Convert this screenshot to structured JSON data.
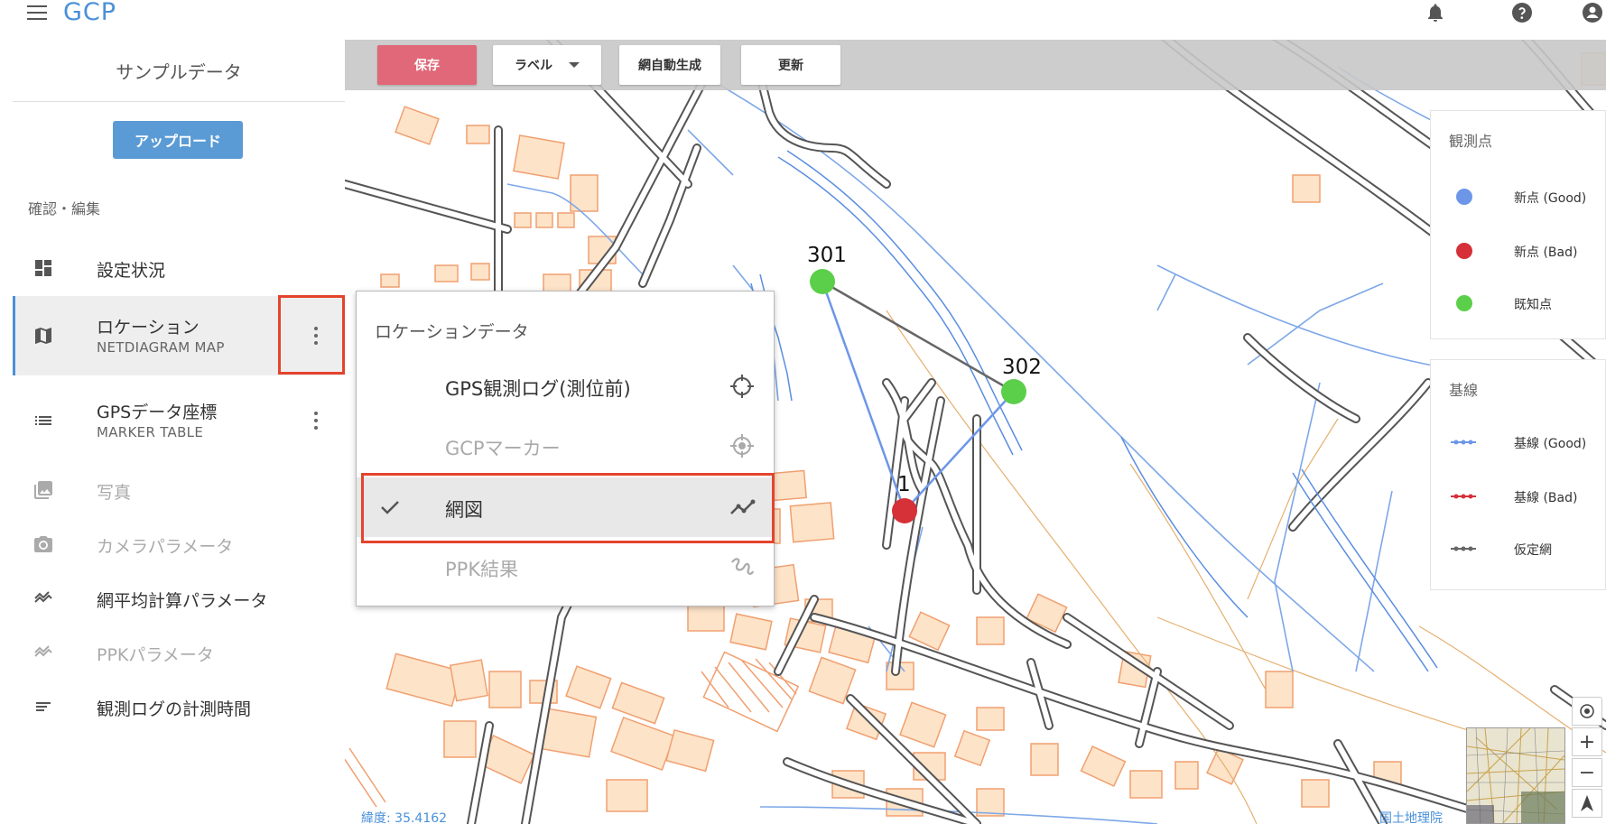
{
  "app": {
    "title": "GCP"
  },
  "sidebar": {
    "project_name": "サンプルデータ",
    "upload_label": "アップロード",
    "section_label": "確認・編集",
    "items": [
      {
        "label": "設定状況",
        "sub": "",
        "icon": "dashboard-icon",
        "state": "normal"
      },
      {
        "label": "ロケーション",
        "sub": "NETDIAGRAM MAP",
        "icon": "map-icon",
        "state": "active"
      },
      {
        "label": "GPSデータ座標",
        "sub": "MARKER TABLE",
        "icon": "list-icon",
        "state": "normal"
      },
      {
        "label": "写真",
        "sub": "",
        "icon": "photo-icon",
        "state": "disabled"
      },
      {
        "label": "カメラパラメータ",
        "sub": "",
        "icon": "camera-icon",
        "state": "disabled"
      },
      {
        "label": "網平均計算パラメータ",
        "sub": "",
        "icon": "trending-icon",
        "state": "normal"
      },
      {
        "label": "PPKパラメータ",
        "sub": "",
        "icon": "trending-icon",
        "state": "disabled"
      },
      {
        "label": "観測ログの計測時間",
        "sub": "",
        "icon": "short-text-icon",
        "state": "normal"
      }
    ]
  },
  "toolbar": {
    "save_label": "保存",
    "label_select": "ラベル",
    "autogen_label": "網自動生成",
    "refresh_label": "更新"
  },
  "dropdown": {
    "header": "ロケーションデータ",
    "items": [
      {
        "label": "GPS観測ログ(測位前)",
        "icon": "crosshair-icon",
        "state": "normal",
        "checked": false
      },
      {
        "label": "GCPマーカー",
        "icon": "gps-fixed-icon",
        "state": "disabled",
        "checked": false
      },
      {
        "label": "網図",
        "icon": "polyline-icon",
        "state": "normal",
        "checked": true
      },
      {
        "label": "PPK結果",
        "icon": "gesture-icon",
        "state": "disabled",
        "checked": false
      }
    ]
  },
  "legend_points": {
    "title": "観測点",
    "items": [
      {
        "label": "新点 (Good)",
        "color": "#6d96e8"
      },
      {
        "label": "新点 (Bad)",
        "color": "#d63038"
      },
      {
        "label": "既知点",
        "color": "#5ccf4a"
      }
    ]
  },
  "legend_lines": {
    "title": "基線",
    "items": [
      {
        "label": "基線 (Good)",
        "color": "#6d96e8"
      },
      {
        "label": "基線 (Bad)",
        "color": "#d63038"
      },
      {
        "label": "仮定網",
        "color": "#666666"
      }
    ]
  },
  "markers": [
    {
      "label": "301",
      "type": "known"
    },
    {
      "label": "302",
      "type": "known"
    },
    {
      "label": "1",
      "type": "new-bad"
    }
  ],
  "footer": {
    "coord_text": "緯度: 35.4162",
    "attribution": "国土地理院"
  }
}
